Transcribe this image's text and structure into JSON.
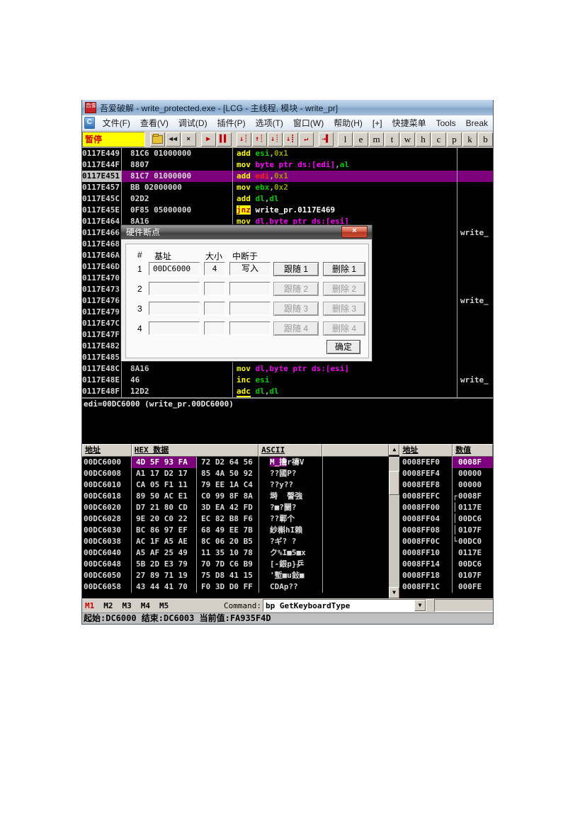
{
  "window": {
    "title": "吾爱破解 - write_protected.exe - [LCG -  主线程, 模块 - write_pr]",
    "menu": [
      "文件(F)",
      "查看(V)",
      "调试(D)",
      "插件(P)",
      "选项(T)",
      "窗口(W)",
      "帮助(H)",
      "[+]",
      "快捷菜单",
      "Tools",
      "Break"
    ],
    "toolbar": {
      "pause_label": "暂停",
      "icons": [
        {
          "name": "open-file-icon",
          "glyph": "FOLDER",
          "color": "#8a6d10"
        },
        {
          "name": "rewind-icon",
          "glyph": "◀◀",
          "color": "#202020"
        },
        {
          "name": "close-icon",
          "glyph": "×",
          "color": "#202020"
        },
        {
          "name": "gap"
        },
        {
          "name": "run-icon",
          "glyph": "▶",
          "color": "#c00000"
        },
        {
          "name": "pause-icon",
          "glyph": "▌▌",
          "color": "#c00000"
        },
        {
          "name": "gap"
        },
        {
          "name": "step-into-icon",
          "glyph": "↓┆",
          "color": "#c00000"
        },
        {
          "name": "step-over-icon",
          "glyph": "↑┆",
          "color": "#c00000"
        },
        {
          "name": "animate-into-icon",
          "glyph": "↓┊",
          "color": "#c00000"
        },
        {
          "name": "animate-over-icon",
          "glyph": "↓┋",
          "color": "#c00000"
        },
        {
          "name": "execute-till-return-icon",
          "glyph": "↵",
          "color": "#c00000"
        },
        {
          "name": "gap"
        },
        {
          "name": "execute-till-user-icon",
          "glyph": "→▌",
          "color": "#c00000"
        }
      ],
      "letters": [
        "l",
        "e",
        "m",
        "t",
        "w",
        "h",
        "c",
        "p",
        "k",
        "b"
      ]
    }
  },
  "disasm": {
    "rows": [
      {
        "addr": "0117E449",
        "bytes": "81C6 01000000",
        "tokens": [
          [
            "add ",
            "m"
          ],
          [
            "esi",
            "r"
          ],
          [
            ",",
            "p"
          ],
          [
            "0x1",
            "i"
          ]
        ],
        "comment": "",
        "sel": false
      },
      {
        "addr": "0117E44F",
        "bytes": "8807",
        "tokens": [
          [
            "mov ",
            "m"
          ],
          [
            "byte ptr ds:[edi]",
            "x"
          ],
          [
            ",",
            "p"
          ],
          [
            "al",
            "r"
          ]
        ],
        "comment": "",
        "sel": false
      },
      {
        "addr": "0117E451",
        "bytes": "81C7 01000000",
        "tokens": [
          [
            "add ",
            "m"
          ],
          [
            "edi",
            "rr"
          ],
          [
            ",",
            "p"
          ],
          [
            "0x1",
            "i"
          ]
        ],
        "comment": "",
        "sel": true
      },
      {
        "addr": "0117E457",
        "bytes": "BB 02000000",
        "tokens": [
          [
            "mov ",
            "m"
          ],
          [
            "ebx",
            "r"
          ],
          [
            ",",
            "p"
          ],
          [
            "0x2",
            "i"
          ]
        ],
        "comment": "",
        "sel": false
      },
      {
        "addr": "0117E45C",
        "bytes": "02D2",
        "tokens": [
          [
            "add ",
            "m"
          ],
          [
            "dl",
            "r"
          ],
          [
            ",",
            "p"
          ],
          [
            "dl",
            "r"
          ]
        ],
        "comment": "",
        "sel": false
      },
      {
        "addr": "0117E45E",
        "bytes": "0F85 05000000",
        "tokens": [
          [
            "jnz",
            "j"
          ],
          [
            " ",
            "p"
          ],
          [
            "write_pr.0117E469",
            "s"
          ]
        ],
        "comment": "",
        "sel": false
      },
      {
        "addr": "0117E464",
        "bytes": "8A16",
        "tokens": [
          [
            "mov ",
            "m"
          ],
          [
            "dl,byte ptr ds:[esi]",
            "x"
          ]
        ],
        "comment": "",
        "sel": false
      },
      {
        "addr": "0117E466",
        "bytes": "",
        "tokens": [],
        "comment": "write_",
        "sel": false
      },
      {
        "addr": "0117E468",
        "bytes": "",
        "tokens": [],
        "comment": "",
        "sel": false
      },
      {
        "addr": "0117E46A",
        "bytes": "",
        "tokens": [],
        "comment": "",
        "sel": false
      },
      {
        "addr": "0117E46D",
        "bytes": "",
        "tokens": [],
        "comment": "",
        "sel": false
      },
      {
        "addr": "0117E470",
        "bytes": "",
        "tokens": [],
        "comment": "",
        "sel": false
      },
      {
        "addr": "0117E473",
        "bytes": "",
        "tokens": [],
        "comment": "",
        "sel": false
      },
      {
        "addr": "0117E476",
        "bytes": "",
        "tokens": [],
        "comment": "write_",
        "sel": false
      },
      {
        "addr": "0117E479",
        "bytes": "",
        "tokens": [],
        "comment": "",
        "sel": false
      },
      {
        "addr": "0117E47C",
        "bytes": "",
        "tokens": [],
        "comment": "",
        "sel": false
      },
      {
        "addr": "0117E47F",
        "bytes": "",
        "tokens": [],
        "comment": "",
        "sel": false
      },
      {
        "addr": "0117E482",
        "bytes": "",
        "tokens": [],
        "comment": "",
        "sel": false
      },
      {
        "addr": "0117E485",
        "bytes": "",
        "tokens": [],
        "comment": "",
        "sel": false
      },
      {
        "addr": "0117E48C",
        "bytes": "8A16",
        "tokens": [
          [
            "mov ",
            "m"
          ],
          [
            "dl,byte ptr ds:[esi]",
            "x"
          ]
        ],
        "comment": "",
        "sel": false
      },
      {
        "addr": "0117E48E",
        "bytes": "46",
        "tokens": [
          [
            "inc ",
            "m"
          ],
          [
            "esi",
            "r"
          ]
        ],
        "comment": "write_",
        "sel": false
      },
      {
        "addr": "0117E48F",
        "bytes": "12D2",
        "tokens": [
          [
            "adc",
            "mu"
          ],
          [
            " ",
            "p"
          ],
          [
            "dl",
            "r"
          ],
          [
            ",",
            "p"
          ],
          [
            "dl",
            "r"
          ]
        ],
        "comment": "",
        "sel": false
      }
    ],
    "info_text": "edi=00DC6000 (write_pr.00DC6000)"
  },
  "dialog": {
    "title": "硬件断点",
    "close_glyph": "×",
    "headers": {
      "num": "#",
      "base": "基址",
      "size": "大小",
      "break_on": "中断于"
    },
    "rows": [
      {
        "num": "1",
        "base": "00DC6000",
        "size": "4",
        "type": "写入",
        "follow": "跟随 1",
        "del": "删除 1",
        "enabled": true
      },
      {
        "num": "2",
        "base": "",
        "size": "",
        "type": "",
        "follow": "跟随 2",
        "del": "删除 2",
        "enabled": false
      },
      {
        "num": "3",
        "base": "",
        "size": "",
        "type": "",
        "follow": "跟随 3",
        "del": "删除 3",
        "enabled": false
      },
      {
        "num": "4",
        "base": "",
        "size": "",
        "type": "",
        "follow": "跟随 4",
        "del": "删除 4",
        "enabled": false
      }
    ],
    "ok_label": "确定"
  },
  "dump": {
    "headers": {
      "addr": "地址",
      "hex": "HEX 数据",
      "ascii": "ASCII"
    },
    "scroll_up": "▲",
    "scroll_down": "▼",
    "rows": [
      {
        "addr": "00DC6000",
        "g1": "4D 5F 93 FA",
        "g2": "72 D2 64 56",
        "ahl": "M_擔",
        "a": "r禱V",
        "hl": true
      },
      {
        "addr": "00DC6008",
        "g1": "A1 17 D2 17",
        "g2": "85 4A 50 92",
        "ahl": "",
        "a": "??國P?",
        "hl": false
      },
      {
        "addr": "00DC6010",
        "g1": "CA 05 F1 11",
        "g2": "79 EE 1A C4",
        "ahl": "",
        "a": "??y??",
        "hl": false
      },
      {
        "addr": "00DC6018",
        "g1": "89 50 AC E1",
        "g2": "C0 99 8F 8A",
        "ahl": "",
        "a": "塒  謦強",
        "hl": false
      },
      {
        "addr": "00DC6020",
        "g1": "D7 21 80 CD",
        "g2": "3D EA 42 FD",
        "ahl": "",
        "a": "?■?闄?",
        "hl": false
      },
      {
        "addr": "00DC6028",
        "g1": "9E 20 C0 22",
        "g2": "EC 82 B8 F6",
        "ahl": "",
        "a": "??鄿个",
        "hl": false
      },
      {
        "addr": "00DC6030",
        "g1": "BC 86 97 EF",
        "g2": "68 49 EE 7B",
        "ahl": "",
        "a": "紗槲hI賴",
        "hl": false
      },
      {
        "addr": "00DC6038",
        "g1": "AC 1F A5 AE",
        "g2": "8C 06 20 B5",
        "ahl": "",
        "a": "?ギ? ?",
        "hl": false
      },
      {
        "addr": "00DC6040",
        "g1": "A5 AF 25 49",
        "g2": "11 35 10 78",
        "ahl": "",
        "a": "ク%I■5■x",
        "hl": false
      },
      {
        "addr": "00DC6048",
        "g1": "5B 2D E3 79",
        "g2": "70 7D C6 B9",
        "ahl": "",
        "a": "[-銀p}乒",
        "hl": false
      },
      {
        "addr": "00DC6050",
        "g1": "27 89 71 19",
        "g2": "75 D8 41 15",
        "ahl": "",
        "a": "'塹■u鈙■",
        "hl": false
      },
      {
        "addr": "00DC6058",
        "g1": "43 44 41 70",
        "g2": "F0 3D D0 FF",
        "ahl": "",
        "a": "CDAp??",
        "hl": false
      }
    ]
  },
  "stack": {
    "headers": {
      "addr": "地址",
      "val": "数值"
    },
    "rows": [
      {
        "addr": "0008FEF0",
        "bracket": "",
        "val": "0008F",
        "hl": true
      },
      {
        "addr": "0008FEF4",
        "bracket": "",
        "val": "00000",
        "hl": false
      },
      {
        "addr": "0008FEF8",
        "bracket": "",
        "val": "00000",
        "hl": false
      },
      {
        "addr": "0008FEFC",
        "bracket": "┌",
        "val": "0008F",
        "hl": false
      },
      {
        "addr": "0008FF00",
        "bracket": "│",
        "val": "0117E",
        "hl": false
      },
      {
        "addr": "0008FF04",
        "bracket": "│",
        "val": "00DC6",
        "hl": false
      },
      {
        "addr": "0008FF08",
        "bracket": "│",
        "val": "0107F",
        "hl": false
      },
      {
        "addr": "0008FF0C",
        "bracket": "└",
        "val": "00DC0",
        "hl": false
      },
      {
        "addr": "0008FF10",
        "bracket": "",
        "val": "0117E",
        "hl": false
      },
      {
        "addr": "0008FF14",
        "bracket": "",
        "val": "00DC6",
        "hl": false
      },
      {
        "addr": "0008FF18",
        "bracket": "",
        "val": "0107F",
        "hl": false
      },
      {
        "addr": "0008FF1C",
        "bracket": "",
        "val": "000FE",
        "hl": false
      }
    ]
  },
  "cmdbar": {
    "tabs": [
      "M1",
      "M2",
      "M3",
      "M4",
      "M5"
    ],
    "command_label": "Command:",
    "command_value": "bp GetKeyboardType",
    "dropdown_glyph": "▼"
  },
  "statusbar": {
    "text": "起始:DC6000 结束:DC6003 当前值:FA935F4D"
  }
}
